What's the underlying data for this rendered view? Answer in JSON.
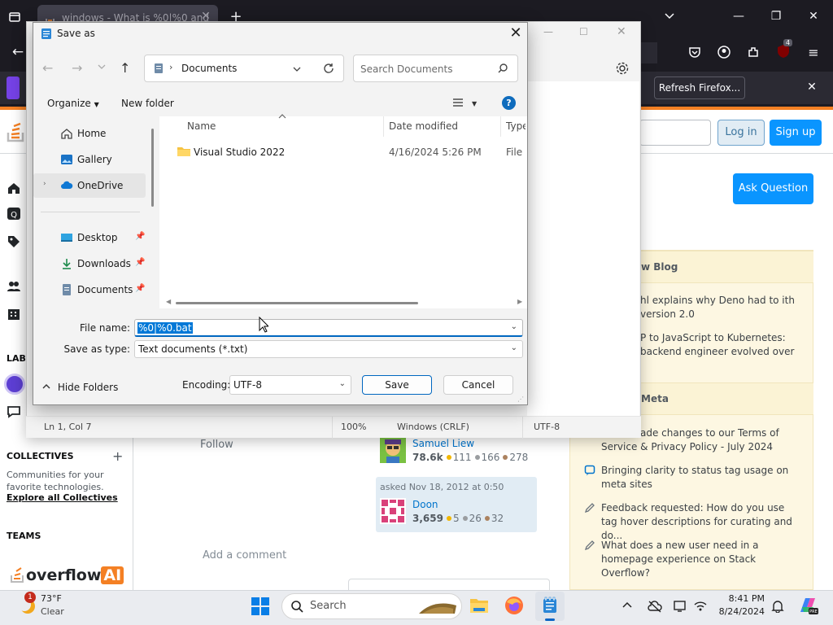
{
  "browser": {
    "tab_title": "windows - What is %0|%0 and",
    "notification_button": "Refresh Firefox...",
    "extension_badge": "4"
  },
  "so": {
    "login": "Log in",
    "signup": "Sign up",
    "ask_question": "Ask Question",
    "labs_label": "LABS",
    "collectives_title": "COLLECTIVES",
    "collectives_desc": "Communities for your favorite technologies.",
    "collectives_link": "Explore all Collectives",
    "teams_title": "TEAMS",
    "overflow_ai": [
      "overflow",
      "AI"
    ],
    "follow": "Follow",
    "add_comment": "Add a comment",
    "editor": {
      "name": "Samuel Liew",
      "rep": "78.6k",
      "gold": "111",
      "silver": "166",
      "bronze": "278"
    },
    "asker": {
      "asked": "asked Nov 18, 2012 at 0:50",
      "name": "Doon",
      "rep": "3,659",
      "gold": "5",
      "silver": "26",
      "bronze": "32"
    },
    "blog": {
      "title": "w Blog",
      "items": [
        "hl explains why Deno had to ith version 2.0",
        "P to JavaScript to Kubernetes: backend engineer evolved over"
      ]
    },
    "meta": {
      "title": "Meta",
      "items": [
        "ade changes to our Terms of Service & Privacy Policy - July 2024",
        "Bringing clarity to status tag usage on meta sites",
        "Feedback requested: How do you use tag hover descriptions for curating and do...",
        "What does a new user need in a homepage experience on Stack Overflow?"
      ]
    },
    "colors": {
      "accent": "#f48024",
      "blue": "#0a95ff",
      "widget": "#fdf7e2"
    }
  },
  "notepad": {
    "status": {
      "position": "Ln 1, Col 7",
      "zoom": "100%",
      "line_ending": "Windows (CRLF)",
      "encoding": "UTF-8"
    }
  },
  "dialog": {
    "title": "Save as",
    "address": "Documents",
    "search_placeholder": "Search Documents",
    "organize": "Organize",
    "new_folder": "New folder",
    "nav": [
      {
        "label": "Home",
        "icon": "home-icon"
      },
      {
        "label": "Gallery",
        "icon": "gallery-icon"
      },
      {
        "label": "OneDrive",
        "icon": "cloud-icon"
      },
      {
        "label": "Desktop",
        "icon": "desktop-icon"
      },
      {
        "label": "Downloads",
        "icon": "download-icon"
      },
      {
        "label": "Documents",
        "icon": "documents-icon"
      }
    ],
    "columns": {
      "name": "Name",
      "date": "Date modified",
      "type": "Type"
    },
    "files": [
      {
        "name": "Visual Studio 2022",
        "date": "4/16/2024 5:26 PM",
        "type": "File fo"
      }
    ],
    "file_name_label": "File name:",
    "file_name_value": "%0|%0.bat",
    "save_type_label": "Save as type:",
    "save_type_value": "Text documents (*.txt)",
    "hide_folders": "Hide Folders",
    "encoding_label": "Encoding:",
    "encoding_value": "UTF-8",
    "save": "Save",
    "cancel": "Cancel"
  },
  "taskbar": {
    "weather_temp": "73°F",
    "weather_cond": "Clear",
    "weather_badge": "1",
    "search": "Search",
    "time": "8:41 PM",
    "date": "8/24/2024"
  }
}
